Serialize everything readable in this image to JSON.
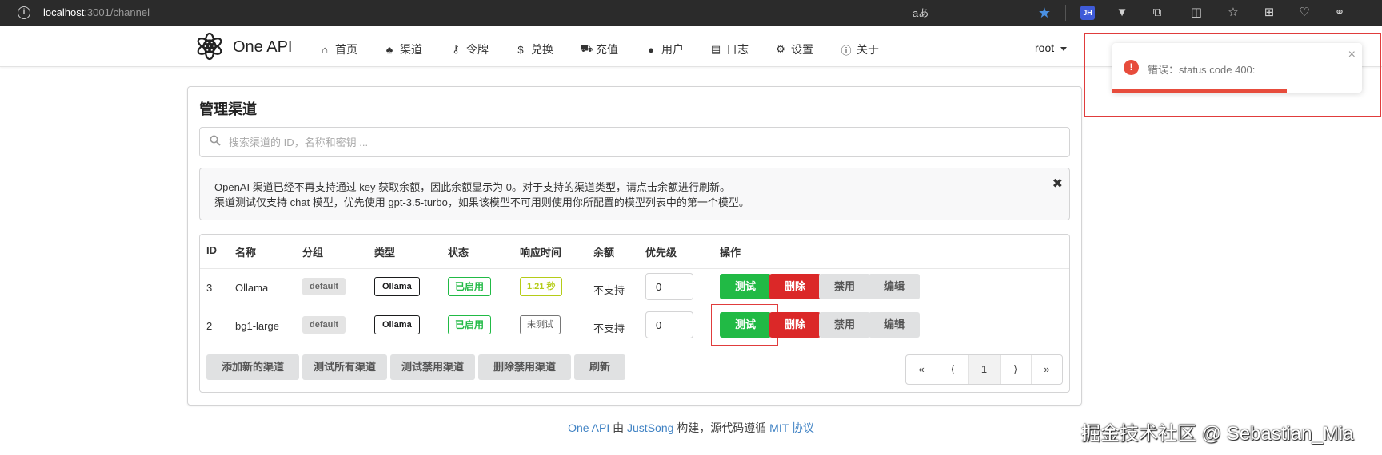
{
  "browser": {
    "url_host": "localhost",
    "url_path": ":3001/channel",
    "read_aloud": "aあ",
    "profile_badge": "JH",
    "icons": [
      "info-icon",
      "read-aloud-icon",
      "favorite-star-icon",
      "profile-badge-icon",
      "vue-devtools-icon",
      "extensions-icon",
      "split-screen-icon",
      "favorites-icon",
      "collections-icon",
      "browser-essentials-icon",
      "copilot-icon"
    ]
  },
  "header": {
    "brand": "One API",
    "nav": [
      {
        "label": "首页",
        "icon": "home-icon"
      },
      {
        "label": "渠道",
        "icon": "sitemap-icon"
      },
      {
        "label": "令牌",
        "icon": "key-icon"
      },
      {
        "label": "兑换",
        "icon": "dollar-icon"
      },
      {
        "label": "充值",
        "icon": "cart-icon"
      },
      {
        "label": "用户",
        "icon": "user-icon"
      },
      {
        "label": "日志",
        "icon": "book-icon"
      },
      {
        "label": "设置",
        "icon": "gear-icon"
      },
      {
        "label": "关于",
        "icon": "info-circle-icon"
      }
    ],
    "user": "root"
  },
  "main": {
    "title": "管理渠道",
    "search_placeholder": "搜索渠道的 ID，名称和密钥 ...",
    "notice_line1": "OpenAI 渠道已经不再支持通过 key 获取余额，因此余额显示为 0。对于支持的渠道类型，请点击余额进行刷新。",
    "notice_line2": "渠道测试仅支持 chat 模型，优先使用 gpt-3.5-turbo，如果该模型不可用则使用你所配置的模型列表中的第一个模型。",
    "notice_close": "✖"
  },
  "table": {
    "headers": [
      "ID",
      "名称",
      "分组",
      "类型",
      "状态",
      "响应时间",
      "余额",
      "优先级",
      "操作"
    ],
    "rows": [
      {
        "id": "3",
        "name": "Ollama",
        "group": "default",
        "type": "Ollama",
        "status": "已启用",
        "response": "1.21 秒",
        "balance": "不支持",
        "priority": "0"
      },
      {
        "id": "2",
        "name": "bg1-large",
        "group": "default",
        "type": "Ollama",
        "status": "已启用",
        "response": "未测试",
        "balance": "不支持",
        "priority": "0"
      }
    ],
    "actions": {
      "test": "测试",
      "delete": "删除",
      "disable": "禁用",
      "edit": "编辑"
    },
    "footer_buttons": [
      "添加新的渠道",
      "测试所有渠道",
      "测试禁用渠道",
      "删除禁用渠道",
      "刷新"
    ],
    "pager": {
      "first": "«",
      "prev": "⟨",
      "page": "1",
      "next": "⟩",
      "last": "»"
    }
  },
  "footer": {
    "part1": "One API",
    "part2": " 由 ",
    "part3": "JustSong",
    "part4": " 构建，源代码遵循 ",
    "part5": "MIT 协议"
  },
  "watermark": "掘金技术社区 @ Sebastian_Mia",
  "toast": {
    "message": "错误：status code 400:",
    "close": "×",
    "progress": 0.7
  },
  "colors": {
    "green": "#21ba45",
    "red": "#db2828",
    "olive": "#b5cc18",
    "link": "#4183c4",
    "toast_red": "#e74c3c"
  }
}
